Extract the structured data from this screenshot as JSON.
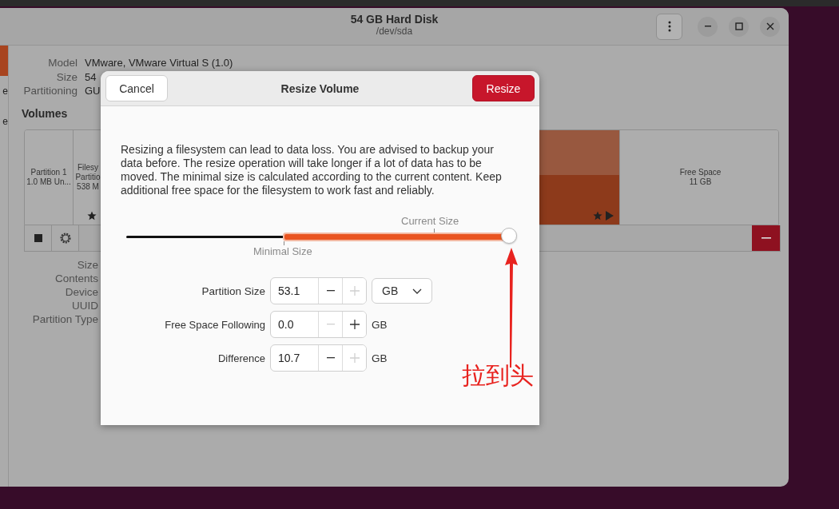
{
  "window": {
    "title": "54 GB Hard Disk",
    "subtitle": "/dev/sda"
  },
  "header_buttons": [
    {
      "kind": "menu"
    },
    {
      "kind": "minimize"
    },
    {
      "kind": "maximize"
    },
    {
      "kind": "close"
    }
  ],
  "sidebar": {
    "items": [
      {
        "selected": true
      },
      {
        "label": "e",
        "selected": false
      },
      {
        "label": "e",
        "selected": false
      }
    ]
  },
  "drive_info": [
    {
      "label": "Model",
      "value": "VMware, VMware Virtual S (1.0)"
    },
    {
      "label": "Size",
      "value": "54"
    },
    {
      "label": "Partitioning",
      "value": "GU"
    }
  ],
  "volumes": {
    "heading": "Volumes",
    "segments": [
      {
        "kind": "partition",
        "lines": [
          "Partition 1",
          "1.0 MB Un..."
        ]
      },
      {
        "kind": "partition",
        "lines": [
          "Filesy",
          "Partitio",
          "538 M"
        ],
        "starred": true
      },
      {
        "kind": "filesystem",
        "starred": true
      },
      {
        "kind": "free",
        "lines": [
          "Free Space",
          "11 GB"
        ]
      }
    ],
    "toolbar": [
      {
        "kind": "stop"
      },
      {
        "kind": "settings"
      },
      {
        "kind": "remove"
      }
    ]
  },
  "partition_info": [
    {
      "label": "Size"
    },
    {
      "label": "Contents"
    },
    {
      "label": "Device"
    },
    {
      "label": "UUID"
    },
    {
      "label": "Partition Type"
    }
  ],
  "dialog": {
    "title": "Resize Volume",
    "cancel": "Cancel",
    "confirm": "Resize",
    "message": "Resizing a filesystem can lead to data loss. You are advised to backup your data before. The resize operation will take longer if a lot of data has to be moved. The minimal size is calculated according to the current content. Keep additional free space for the filesystem to work fast and reliably.",
    "slider": {
      "current_label": "Current Size",
      "minimal_label": "Minimal Size",
      "level": 1.0
    },
    "fields": [
      {
        "label": "Partition Size",
        "value": "53.1",
        "minus_disabled": false,
        "plus_disabled": true,
        "unit": {
          "kind": "dropdown",
          "text": "GB"
        }
      },
      {
        "label": "Free Space Following",
        "value": "0.0",
        "minus_disabled": true,
        "plus_disabled": false,
        "unit": {
          "kind": "text",
          "text": "GB"
        }
      },
      {
        "label": "Difference",
        "value": "10.7",
        "minus_disabled": false,
        "plus_disabled": true,
        "unit": {
          "kind": "text",
          "text": "GB"
        }
      }
    ]
  },
  "annotation": {
    "text": "拉到头"
  }
}
